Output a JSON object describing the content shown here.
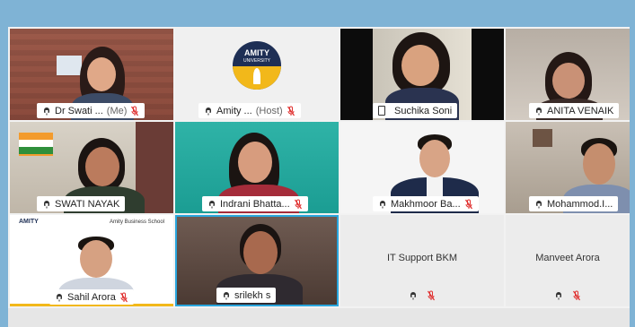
{
  "participants": [
    {
      "id": "p1",
      "name": "Dr Swati ...",
      "suffix": "(Me)",
      "mic": "off"
    },
    {
      "id": "p2",
      "name": "Amity ...",
      "suffix": "(Host)",
      "mic": "off",
      "logo_text": "AMITY",
      "logo_sub": "UNIVERSITY"
    },
    {
      "id": "p3",
      "name": "Suchika Soni",
      "mic": "none"
    },
    {
      "id": "p4",
      "name": "ANITA VENAIK",
      "mic": "on"
    },
    {
      "id": "p5",
      "name": "SWATI NAYAK",
      "mic": "on"
    },
    {
      "id": "p6",
      "name": "Indrani Bhatta...",
      "mic": "off"
    },
    {
      "id": "p7",
      "name": "Makhmoor Ba...",
      "mic": "off"
    },
    {
      "id": "p8",
      "name": "Mohammod.I...",
      "mic": "on"
    },
    {
      "id": "p9",
      "name": "Sahil Arora",
      "mic": "off",
      "banner_left": "AMITY",
      "banner_right": "Amity Business School"
    },
    {
      "id": "p10",
      "name": "srilekh s",
      "mic": "on"
    },
    {
      "id": "p11",
      "name": "IT Support BKM",
      "mic": "off"
    },
    {
      "id": "p12",
      "name": "Manveet Arora",
      "mic": "off"
    }
  ],
  "colors": {
    "active_border": "#29a6de",
    "mic_off": "#e0302f",
    "background": "#7fb3d5"
  }
}
